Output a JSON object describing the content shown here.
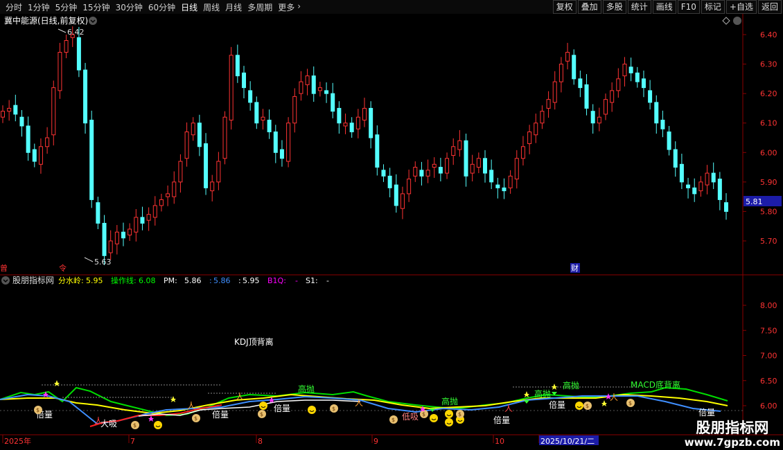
{
  "toolbar": {
    "periods": [
      "分时",
      "1分钟",
      "5分钟",
      "15分钟",
      "30分钟",
      "60分钟",
      "日线",
      "周线",
      "月线",
      "多周期",
      "更多"
    ],
    "active_period": "日线",
    "right_buttons": [
      "复权",
      "叠加",
      "多股",
      "统计",
      "画线",
      "F10",
      "标记",
      "+自选",
      "返回"
    ]
  },
  "main_panel": {
    "stock_title": "冀中能源(日线,前复权)",
    "price_axis_ticks": [
      "6.40",
      "6.30",
      "6.20",
      "6.10",
      "6.00",
      "5.90",
      "5.80",
      "5.70"
    ],
    "current_price": "5.81",
    "high_label": "6.42",
    "low_label": "5.63",
    "event_markers": [
      "曾",
      "令",
      "财"
    ]
  },
  "indicator_panel": {
    "name": "股朋指标网",
    "legend": [
      {
        "label": "分水岭:",
        "value": "5.95",
        "color": "#ffff00"
      },
      {
        "label": "操作线:",
        "value": "6.08",
        "color": "#00ff00"
      },
      {
        "label": "PM:",
        "value": "5.86",
        "color": "#ffffff"
      },
      {
        "label": ":",
        "value": "5.86",
        "color": "#3f8fff"
      },
      {
        "label": ":",
        "value": "5.95",
        "color": "#ffffff"
      },
      {
        "label": "B1Q:",
        "value": "-",
        "color": "#ff00ff"
      },
      {
        "label": "S1:",
        "value": "-",
        "color": "#ffffff"
      }
    ],
    "axis_ticks": [
      "8.00",
      "7.50",
      "7.00",
      "6.50",
      "6.00"
    ],
    "annotations": [
      "KDJ顶背离",
      "高抛",
      "高抛",
      "高抛",
      "高抛",
      "MACD底背离",
      "低吸",
      "大吸",
      "倍量",
      "倍量",
      "倍量",
      "倍量",
      "倍量",
      "倍量"
    ]
  },
  "date_axis": {
    "labels": [
      "2025年",
      "7",
      "8",
      "9",
      "10",
      "2025/10/21/二"
    ]
  },
  "watermark": {
    "title": "股朋指标网",
    "url": "www.7gpzb.com"
  },
  "chart_data": {
    "type": "candlestick",
    "title": "冀中能源(日线,前复权)",
    "ylim": [
      5.6,
      6.46
    ],
    "close": [
      6.14,
      6.15,
      6.13,
      6.09,
      6.0,
      5.97,
      6.02,
      6.05,
      6.22,
      6.34,
      6.38,
      6.4,
      6.28,
      6.1,
      5.84,
      5.76,
      5.65,
      5.7,
      5.73,
      5.71,
      5.74,
      5.78,
      5.76,
      5.79,
      5.82,
      5.84,
      5.86,
      5.9,
      5.97,
      6.07,
      6.1,
      6.02,
      5.88,
      5.9,
      5.97,
      6.12,
      6.33,
      6.26,
      6.22,
      6.17,
      6.1,
      6.12,
      6.07,
      6.0,
      5.98,
      6.1,
      6.19,
      6.24,
      6.26,
      6.2,
      6.22,
      6.2,
      6.14,
      6.1,
      6.1,
      6.07,
      6.12,
      6.15,
      6.05,
      5.95,
      5.92,
      5.88,
      5.82,
      5.86,
      5.91,
      5.95,
      5.92,
      5.94,
      5.96,
      5.93,
      5.98,
      6.02,
      6.04,
      5.92,
      5.96,
      5.98,
      5.93,
      5.9,
      5.88,
      5.87,
      5.92,
      5.98,
      6.02,
      6.07,
      6.1,
      6.14,
      6.18,
      6.24,
      6.3,
      6.34,
      6.25,
      6.22,
      6.15,
      6.1,
      6.12,
      6.18,
      6.21,
      6.25,
      6.3,
      6.27,
      6.24,
      6.22,
      6.17,
      6.1,
      6.08,
      6.01,
      5.95,
      5.9,
      5.88,
      5.86,
      5.9,
      5.93,
      5.9,
      5.84,
      5.8
    ]
  }
}
